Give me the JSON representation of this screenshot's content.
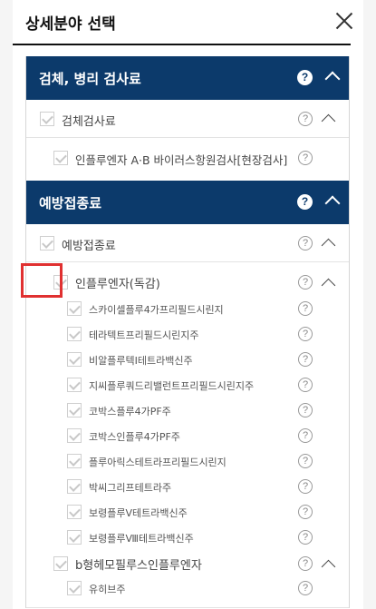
{
  "header": {
    "title": "상세분야 선택"
  },
  "sections": [
    {
      "title": "검체, 병리 검사료",
      "group": "검체검사료",
      "items": [
        "인플루엔자 A·B 바이러스항원검사[현장검사]"
      ]
    },
    {
      "title": "예방접종료",
      "group": "예방접종료",
      "subgroup": "인플루엔자(독감)",
      "sub_items": [
        "스카이셀플루4가프리필드시린지",
        "테라텍트프리필드시린지주",
        "비알플루텍I테트라백신주",
        "지씨플루쿼드리밸런트프리필드시린지주",
        "코박스플루4가PF주",
        "코박스인플루4가PF주",
        "플루아릭스테트라프리필드시린지",
        "박씨그리프테트라주",
        "보령플루Ⅴ테트라백신주",
        "보령플루Ⅷ테트라백신주"
      ],
      "subgroup2": "b형헤모필루스인플루엔자",
      "sub_items2": [
        "유히브주"
      ]
    }
  ],
  "help_glyph": "?"
}
